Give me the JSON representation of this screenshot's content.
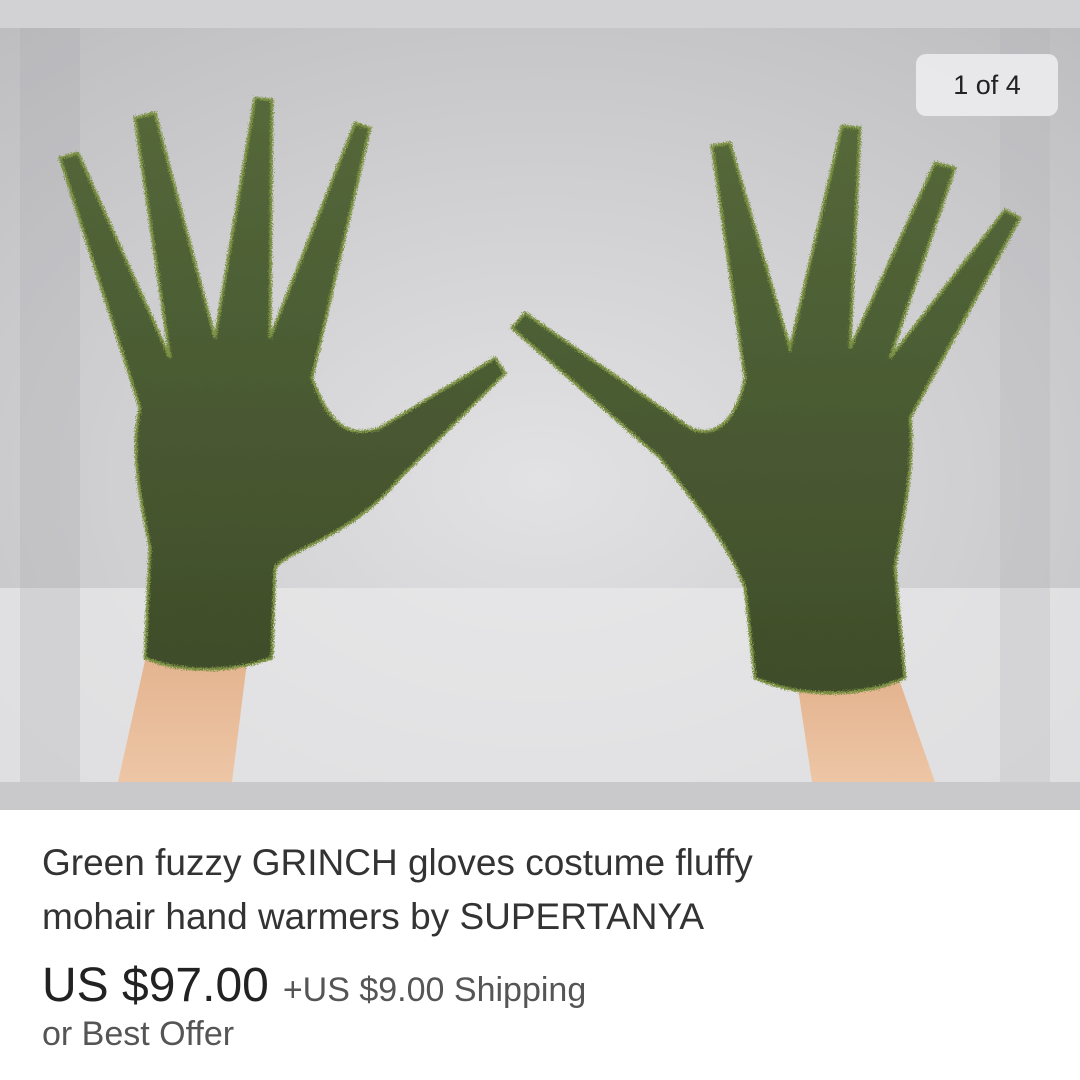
{
  "gallery": {
    "counter": "1 of 4",
    "image_subject": "green-fuzzy-gloves-photo"
  },
  "listing": {
    "title_line1": "Green fuzzy GRINCH gloves costume fluffy",
    "title_line2": "mohair hand warmers by SUPERTANYA",
    "price": "US $97.00",
    "shipping": "+US $9.00 Shipping",
    "offer": "or Best Offer"
  },
  "colors": {
    "glove_green": "#4a5a2e",
    "glove_highlight": "#7a8f3e",
    "skin": "#e8bc98",
    "background_snow": "#d8d8da"
  }
}
